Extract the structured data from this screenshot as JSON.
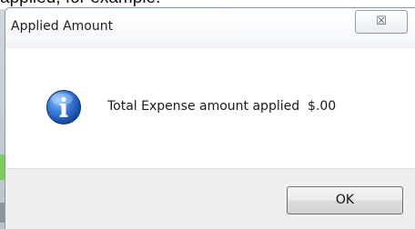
{
  "background": {
    "partial_text": "applied, for example:"
  },
  "window": {
    "title": "Applied Amount",
    "close_glyph": "☒"
  },
  "message": {
    "icon": "info-icon",
    "text": "Total Expense amount applied  $.00"
  },
  "buttons": {
    "ok_label": "OK"
  },
  "colors": {
    "info_icon_blue": "#2a6fce",
    "button_bar": "#efefef"
  }
}
